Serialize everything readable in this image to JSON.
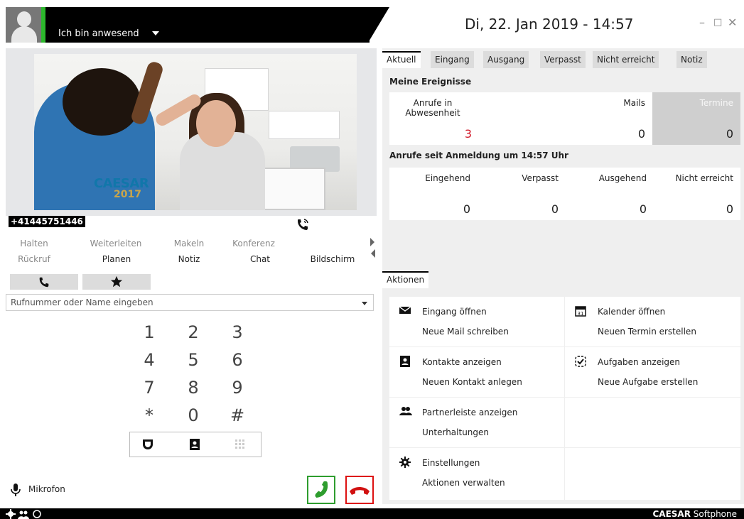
{
  "header": {
    "status": "Ich bin anwesend",
    "datetime": "Di, 22. Jan 2019 - 14:57",
    "minimize": "–",
    "maximize": "□",
    "close": "✕"
  },
  "call": {
    "number": "+41445751446",
    "photo_logo": "CAESAR",
    "photo_logo_year": "2017"
  },
  "actions_row1": [
    {
      "label": "Halten"
    },
    {
      "label": "Weiterleiten"
    },
    {
      "label": "Makeln"
    },
    {
      "label": "Konferenz"
    }
  ],
  "actions_row2": [
    {
      "label": "Rückruf"
    },
    {
      "label": "Planen"
    },
    {
      "label": "Notiz"
    },
    {
      "label": "Chat"
    },
    {
      "label": "Bildschirm"
    }
  ],
  "dialer": {
    "placeholder": "Rufnummer oder Name eingeben",
    "keys": [
      "1",
      "2",
      "3",
      "4",
      "5",
      "6",
      "7",
      "8",
      "9",
      "*",
      "0",
      "#"
    ],
    "mic_label": "Mikrofon"
  },
  "tabs": [
    "Aktuell",
    "Eingang",
    "Ausgang",
    "Verpasst",
    "Nicht erreicht",
    "Notiz"
  ],
  "events": {
    "title": "Meine Ereignisse",
    "cards": [
      {
        "label": "Anrufe in Abwesenheit",
        "value": "3"
      },
      {
        "label": "Mails",
        "value": "0"
      },
      {
        "label": "Termine",
        "value": "0"
      }
    ]
  },
  "calls_since": {
    "title": "Anrufe seit Anmeldung um 14:57 Uhr",
    "cards": [
      {
        "label": "Eingehend",
        "value": "0"
      },
      {
        "label": "Verpasst",
        "value": "0"
      },
      {
        "label": "Ausgehend",
        "value": "0"
      },
      {
        "label": "Nicht erreicht",
        "value": "0"
      }
    ]
  },
  "aktionen": {
    "tab": "Aktionen",
    "items": [
      {
        "l1": "Eingang öffnen",
        "l2": "Neue Mail schreiben",
        "icon": "mail-icon"
      },
      {
        "l1": "Kalender öffnen",
        "l2": "Neuen Termin erstellen",
        "icon": "calendar-icon"
      },
      {
        "l1": "Kontakte anzeigen",
        "l2": "Neuen Kontakt anlegen",
        "icon": "contacts-icon"
      },
      {
        "l1": "Aufgaben anzeigen",
        "l2": "Neue Aufgabe erstellen",
        "icon": "task-icon"
      },
      {
        "l1": "Partnerleiste anzeigen",
        "l2": "Unterhaltungen",
        "icon": "partners-icon"
      },
      {
        "l1": "Einstellungen",
        "l2": "Aktionen verwalten",
        "icon": "gear-icon"
      }
    ]
  },
  "statusbar": {
    "brand_bold": "CAESAR",
    "brand_rest": " Softphone"
  },
  "colors": {
    "presence": "#2db82d",
    "missed": "#d11a2a",
    "call": "#2e9d2e",
    "hangup": "#d11111"
  }
}
